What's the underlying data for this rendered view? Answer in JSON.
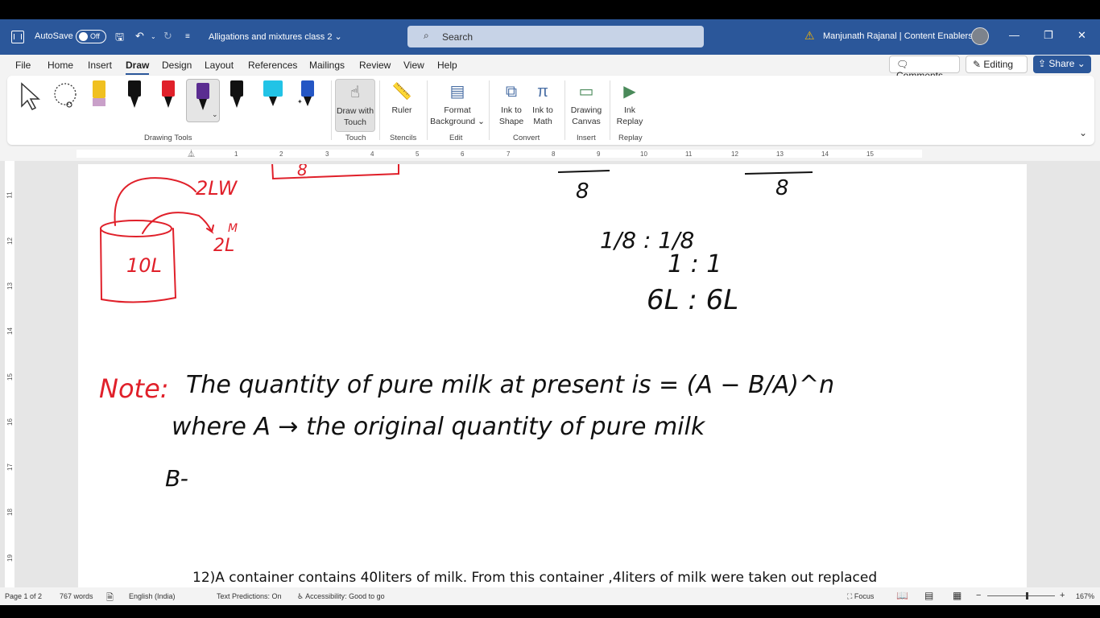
{
  "titlebar": {
    "autosave_label": "AutoSave",
    "autosave_state": "Off",
    "doc_title": "Alligations and mixtures class 2",
    "search_placeholder": "Search",
    "user_name": "Manjunath Rajanal | Content Enablers"
  },
  "menu": {
    "tabs": [
      "File",
      "Home",
      "Insert",
      "Draw",
      "Design",
      "Layout",
      "References",
      "Mailings",
      "Review",
      "View",
      "Help"
    ],
    "active": "Draw",
    "comments": "Comments",
    "editing": "Editing",
    "share": "Share"
  },
  "ribbon": {
    "groups": {
      "drawing_tools": "Drawing Tools",
      "touch": "Touch",
      "stencils": "Stencils",
      "edit": "Edit",
      "convert": "Convert",
      "insert": "Insert",
      "replay": "Replay"
    },
    "buttons": {
      "draw_with_touch_1": "Draw with",
      "draw_with_touch_2": "Touch",
      "ruler": "Ruler",
      "format_bg_1": "Format",
      "format_bg_2": "Background",
      "ink_to_shape_1": "Ink to",
      "ink_to_shape_2": "Shape",
      "ink_to_math_1": "Ink to",
      "ink_to_math_2": "Math",
      "drawing_canvas_1": "Drawing",
      "drawing_canvas_2": "Canvas",
      "ink_replay_1": "Ink",
      "ink_replay_2": "Replay"
    },
    "pen_colors": [
      "#f0c020",
      "#111111",
      "#e0202a",
      "#5b2d91",
      "#111111",
      "#22c3e6",
      "#2456c4"
    ]
  },
  "ruler_numbers": [
    "1",
    "2",
    "3",
    "4",
    "5",
    "6",
    "7",
    "8",
    "9",
    "10",
    "11",
    "12",
    "13",
    "14",
    "15"
  ],
  "vruler_numbers": [
    "11",
    "12",
    "13",
    "14",
    "15",
    "16",
    "17",
    "18",
    "19"
  ],
  "document": {
    "ink": {
      "left_top": "2LW",
      "container": "10L",
      "arrow_label": "2L",
      "arrow_label_m": "M",
      "frac_left_den": "8",
      "frac_right_den": "8",
      "ratio_1": "1/8 : 1/8",
      "ratio_2": "1 : 1",
      "ratio_3": "6L : 6L",
      "note_label": "Note:",
      "note_text": "The quantity of pure milk at present is = (A − B/A)^n",
      "note_line2": "where A → the original quantity of pure milk",
      "note_line3": "B-"
    },
    "paragraph": "12)A container contains 40liters of milk. From this container ,4liters of milk were taken out replaced"
  },
  "status": {
    "page": "Page 1 of 2",
    "words": "767 words",
    "language": "English (India)",
    "predictions": "Text Predictions: On",
    "accessibility": "Accessibility: Good to go",
    "focus": "Focus",
    "zoom": "167%"
  }
}
